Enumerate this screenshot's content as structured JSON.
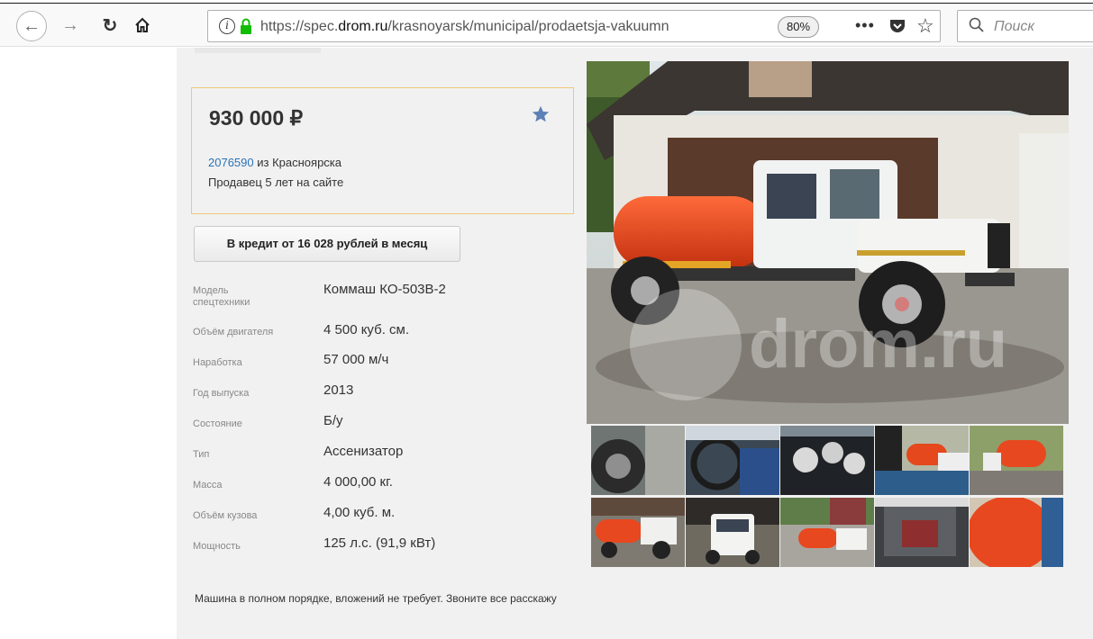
{
  "browser": {
    "url_prefix": "https://spec.",
    "url_domain": "drom.ru",
    "url_path": "/krasnoyarsk/municipal/prodaetsja-vakuumn",
    "zoom": "80%",
    "more_icon": "•••",
    "search_placeholder": "Поиск"
  },
  "listing": {
    "price": "930 000",
    "currency": "₽",
    "seller_id": "2076590",
    "seller_from": "из Красноярска",
    "seller_since": "Продавец 5 лет на сайте",
    "credit_button": "В кредит от 16 028 рублей в месяц",
    "specs": [
      {
        "label": "Модель спецтехники",
        "value": "Коммаш КО-503В-2"
      },
      {
        "label": "Объём двигателя",
        "value": "4 500 куб. см."
      },
      {
        "label": "Наработка",
        "value": "57 000 м/ч"
      },
      {
        "label": "Год выпуска",
        "value": "2013"
      },
      {
        "label": "Состояние",
        "value": "Б/у"
      },
      {
        "label": "Тип",
        "value": "Ассенизатор"
      },
      {
        "label": "Масса",
        "value": "4 000,00 кг."
      },
      {
        "label": "Объём кузова",
        "value": "4,00 куб. м."
      },
      {
        "label": "Мощность",
        "value": "125 л.с. (91,9 кВт)"
      }
    ],
    "description": "Машина в полном порядке, вложений не требует. Звоните все расскажу",
    "watermark": "drom.ru"
  },
  "colors": {
    "accent_border": "#f0c877",
    "link": "#2b74b8",
    "star": "#5d81b6",
    "tank": "#e8481f"
  }
}
